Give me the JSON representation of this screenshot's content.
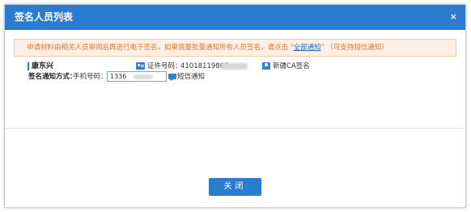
{
  "dialog": {
    "title": "签名人员列表",
    "close_glyph": "×"
  },
  "notice": {
    "text_before": "申请材料由相关人员审阅后再进行电子签名。如果需要批量通知所有人员签名，请点击 \"",
    "link": "全部通知",
    "text_after": "\" （可支持短信通知）"
  },
  "signer": {
    "name": "康东兴",
    "id_label": "证件号码：",
    "id_value": "41018119860",
    "ca_label": "新疆CA签名"
  },
  "notify": {
    "label": "签名通知方式：",
    "phone_label": "手机号码：",
    "phone_value": "1336",
    "sms_label": "短信通知"
  },
  "footer": {
    "close_label": "关闭"
  },
  "colors": {
    "titlebar": "#2b7bd1",
    "notice_text": "#e8762c",
    "notice_bg": "#fdf0e6",
    "link": "#2b6cc4",
    "button": "#2b7bd1"
  },
  "icons": [
    "close-icon",
    "id-card-icon",
    "ca-seal-icon",
    "sms-icon"
  ]
}
